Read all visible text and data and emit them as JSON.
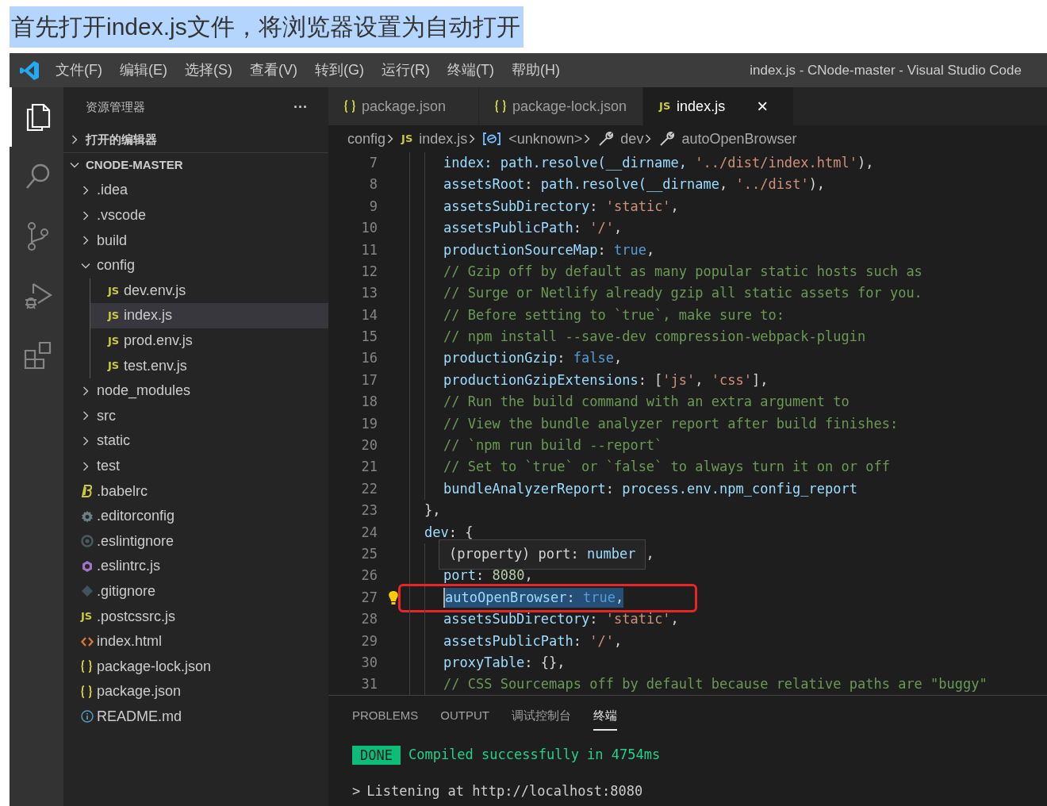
{
  "caption": "首先打开index.js文件，将浏览器设置为自动打开",
  "window": {
    "title": "index.js - CNode-master - Visual Studio Code"
  },
  "menu": [
    "文件(F)",
    "编辑(E)",
    "选择(S)",
    "查看(V)",
    "转到(G)",
    "运行(R)",
    "终端(T)",
    "帮助(H)"
  ],
  "activity_bar": [
    {
      "kind": "files",
      "selected": true
    },
    {
      "kind": "search",
      "selected": false
    },
    {
      "kind": "scm",
      "selected": false
    },
    {
      "kind": "debug",
      "selected": false
    },
    {
      "kind": "extensions",
      "selected": false
    }
  ],
  "sidebar": {
    "title": "资源管理器",
    "more": "···",
    "sections": [
      {
        "label": "打开的编辑器",
        "expanded": false
      },
      {
        "label": "CNODE-MASTER",
        "expanded": true
      }
    ],
    "items": [
      {
        "kind": "folder",
        "label": ".idea",
        "expanded": false,
        "selected": false
      },
      {
        "kind": "folder",
        "label": ".vscode",
        "expanded": false,
        "selected": false
      },
      {
        "kind": "folder",
        "label": "build",
        "expanded": false,
        "selected": false
      },
      {
        "kind": "folder",
        "label": "config",
        "expanded": true,
        "selected": false,
        "children": [
          {
            "kind": "js",
            "badge": "JS",
            "label": "dev.env.js",
            "selected": false
          },
          {
            "kind": "js",
            "badge": "JS",
            "label": "index.js",
            "selected": true
          },
          {
            "kind": "js",
            "badge": "JS",
            "label": "prod.env.js",
            "selected": false
          },
          {
            "kind": "js",
            "badge": "JS",
            "label": "test.env.js",
            "selected": false
          }
        ]
      },
      {
        "kind": "folder",
        "label": "node_modules",
        "expanded": false,
        "selected": false
      },
      {
        "kind": "folder",
        "label": "src",
        "expanded": false,
        "selected": false
      },
      {
        "kind": "folder",
        "label": "static",
        "expanded": false,
        "selected": false
      },
      {
        "kind": "folder",
        "label": "test",
        "expanded": false,
        "selected": false
      },
      {
        "kind": "babel",
        "label": ".babelrc",
        "selected": false
      },
      {
        "kind": "gear",
        "label": ".editorconfig",
        "selected": false
      },
      {
        "kind": "ring",
        "label": ".eslintignore",
        "selected": false
      },
      {
        "kind": "eslint",
        "label": ".eslintrc.js",
        "selected": false
      },
      {
        "kind": "git",
        "label": ".gitignore",
        "selected": false
      },
      {
        "kind": "js",
        "badge": "JS",
        "label": ".postcssrc.js",
        "selected": false
      },
      {
        "kind": "html",
        "label": "index.html",
        "selected": false
      },
      {
        "kind": "json",
        "label": "package-lock.json",
        "selected": false
      },
      {
        "kind": "json",
        "label": "package.json",
        "selected": false
      },
      {
        "kind": "info",
        "label": "README.md",
        "selected": false
      }
    ]
  },
  "tabs": [
    {
      "kind": "json",
      "label": "package.json",
      "selected": false
    },
    {
      "kind": "json",
      "label": "package-lock.json",
      "selected": false
    },
    {
      "kind": "js",
      "badge": "JS",
      "label": "index.js",
      "selected": true,
      "close": "×"
    }
  ],
  "breadcrumb": [
    {
      "kind": "folder",
      "label": "config"
    },
    {
      "kind": "js",
      "badge": "JS",
      "label": "index.js"
    },
    {
      "kind": "symbol",
      "label": "<unknown>"
    },
    {
      "kind": "wrench",
      "label": "dev"
    },
    {
      "kind": "wrench",
      "label": "autoOpenBrowser"
    }
  ],
  "editor": {
    "lines": [
      {
        "n": "7",
        "indented": true,
        "tokens": [
          {
            "kind": "prop",
            "text": "index: path.resolve(__dirname, "
          },
          {
            "kind": "string",
            "text": "'../dist/index.html'"
          },
          {
            "kind": "plain",
            "text": "),"
          }
        ]
      },
      {
        "n": "8",
        "indented": true,
        "tokens": [
          {
            "kind": "prop",
            "text": "assetsRoot"
          },
          {
            "kind": "plain",
            "text": ": "
          },
          {
            "kind": "prop",
            "text": "path.resolve(__dirname"
          },
          {
            "kind": "plain",
            "text": ", "
          },
          {
            "kind": "string",
            "text": "'../dist'"
          },
          {
            "kind": "plain",
            "text": "),"
          }
        ]
      },
      {
        "n": "9",
        "indented": true,
        "tokens": [
          {
            "kind": "prop",
            "text": "assetsSubDirectory"
          },
          {
            "kind": "plain",
            "text": ": "
          },
          {
            "kind": "string",
            "text": "'static'"
          },
          {
            "kind": "plain",
            "text": ","
          }
        ]
      },
      {
        "n": "10",
        "indented": true,
        "tokens": [
          {
            "kind": "prop",
            "text": "assetsPublicPath"
          },
          {
            "kind": "plain",
            "text": ": "
          },
          {
            "kind": "string",
            "text": "'/'"
          },
          {
            "kind": "plain",
            "text": ","
          }
        ]
      },
      {
        "n": "11",
        "indented": true,
        "tokens": [
          {
            "kind": "prop",
            "text": "productionSourceMap"
          },
          {
            "kind": "plain",
            "text": ": "
          },
          {
            "kind": "keyword",
            "text": "true"
          },
          {
            "kind": "plain",
            "text": ","
          }
        ]
      },
      {
        "n": "12",
        "indented": true,
        "tokens": [
          {
            "kind": "comment",
            "text": "// Gzip off by default as many popular static hosts such as"
          }
        ]
      },
      {
        "n": "13",
        "indented": true,
        "tokens": [
          {
            "kind": "comment",
            "text": "// Surge or Netlify already gzip all static assets for you."
          }
        ]
      },
      {
        "n": "14",
        "indented": true,
        "tokens": [
          {
            "kind": "comment",
            "text": "// Before setting to `true`, make sure to:"
          }
        ]
      },
      {
        "n": "15",
        "indented": true,
        "tokens": [
          {
            "kind": "comment",
            "text": "// npm install --save-dev compression-webpack-plugin"
          }
        ]
      },
      {
        "n": "16",
        "indented": true,
        "tokens": [
          {
            "kind": "prop",
            "text": "productionGzip"
          },
          {
            "kind": "plain",
            "text": ": "
          },
          {
            "kind": "keyword",
            "text": "false"
          },
          {
            "kind": "plain",
            "text": ","
          }
        ]
      },
      {
        "n": "17",
        "indented": true,
        "tokens": [
          {
            "kind": "prop",
            "text": "productionGzipExtensions"
          },
          {
            "kind": "plain",
            "text": ": ["
          },
          {
            "kind": "string",
            "text": "'js'"
          },
          {
            "kind": "plain",
            "text": ", "
          },
          {
            "kind": "string",
            "text": "'css'"
          },
          {
            "kind": "plain",
            "text": "],"
          }
        ]
      },
      {
        "n": "18",
        "indented": true,
        "tokens": [
          {
            "kind": "comment",
            "text": "// Run the build command with an extra argument to"
          }
        ]
      },
      {
        "n": "19",
        "indented": true,
        "tokens": [
          {
            "kind": "comment",
            "text": "// View the bundle analyzer report after build finishes:"
          }
        ]
      },
      {
        "n": "20",
        "indented": true,
        "tokens": [
          {
            "kind": "comment",
            "text": "// `npm run build --report`"
          }
        ]
      },
      {
        "n": "21",
        "indented": true,
        "tokens": [
          {
            "kind": "comment",
            "text": "// Set to `true` or `false` to always turn it on or off"
          }
        ]
      },
      {
        "n": "22",
        "indented": true,
        "tokens": [
          {
            "kind": "prop",
            "text": "bundleAnalyzerReport"
          },
          {
            "kind": "plain",
            "text": ": "
          },
          {
            "kind": "prop",
            "text": "process.env.npm_config_report"
          }
        ]
      },
      {
        "n": "23",
        "indented": false,
        "tokens": [
          {
            "kind": "plain",
            "text": "},"
          }
        ]
      },
      {
        "n": "24",
        "indented": false,
        "tokens": [
          {
            "kind": "prop",
            "text": "dev"
          },
          {
            "kind": "plain",
            "text": ": {"
          }
        ]
      },
      {
        "n": "25",
        "indented": true,
        "hover": [
          {
            "kind": "plain",
            "text": "(property) port: "
          },
          {
            "kind": "prop",
            "text": "number"
          }
        ],
        "tokens": [
          {
            "kind": "plain",
            "text": ","
          }
        ]
      },
      {
        "n": "26",
        "indented": true,
        "tokens": [
          {
            "kind": "prop",
            "text": "port"
          },
          {
            "kind": "plain",
            "text": ": "
          },
          {
            "kind": "number",
            "text": "8080"
          },
          {
            "kind": "plain",
            "text": ","
          }
        ]
      },
      {
        "n": "27",
        "indented": true,
        "selected": true,
        "annotated": true,
        "lightbulb": true,
        "tokens": [
          {
            "kind": "prop",
            "text": "autoOpenBrowser"
          },
          {
            "kind": "plain",
            "text": ": "
          },
          {
            "kind": "keyword",
            "text": "true"
          },
          {
            "kind": "plain",
            "text": ","
          }
        ]
      },
      {
        "n": "28",
        "indented": true,
        "tokens": [
          {
            "kind": "prop",
            "text": "assetsSubDirectory"
          },
          {
            "kind": "plain",
            "text": ": "
          },
          {
            "kind": "string",
            "text": "'static'"
          },
          {
            "kind": "plain",
            "text": ","
          }
        ]
      },
      {
        "n": "29",
        "indented": true,
        "tokens": [
          {
            "kind": "prop",
            "text": "assetsPublicPath"
          },
          {
            "kind": "plain",
            "text": ": "
          },
          {
            "kind": "string",
            "text": "'/'"
          },
          {
            "kind": "plain",
            "text": ","
          }
        ]
      },
      {
        "n": "30",
        "indented": true,
        "tokens": [
          {
            "kind": "prop",
            "text": "proxyTable"
          },
          {
            "kind": "plain",
            "text": ": {},"
          }
        ]
      },
      {
        "n": "31",
        "indented": true,
        "tokens": [
          {
            "kind": "comment",
            "text": "// CSS Sourcemaps off by default because relative paths are \"buggy\""
          }
        ]
      }
    ]
  },
  "panel": {
    "tabs": [
      {
        "label": "PROBLEMS",
        "selected": false
      },
      {
        "label": "OUTPUT",
        "selected": false
      },
      {
        "label": "调试控制台",
        "selected": false
      },
      {
        "label": "终端",
        "selected": true
      }
    ],
    "terminal": [
      {
        "kind": "status",
        "badge": "DONE",
        "text": "Compiled successfully in 4754ms"
      },
      {
        "kind": "prompt",
        "prompt": ">",
        "text": "Listening at http://localhost:8080"
      }
    ]
  }
}
